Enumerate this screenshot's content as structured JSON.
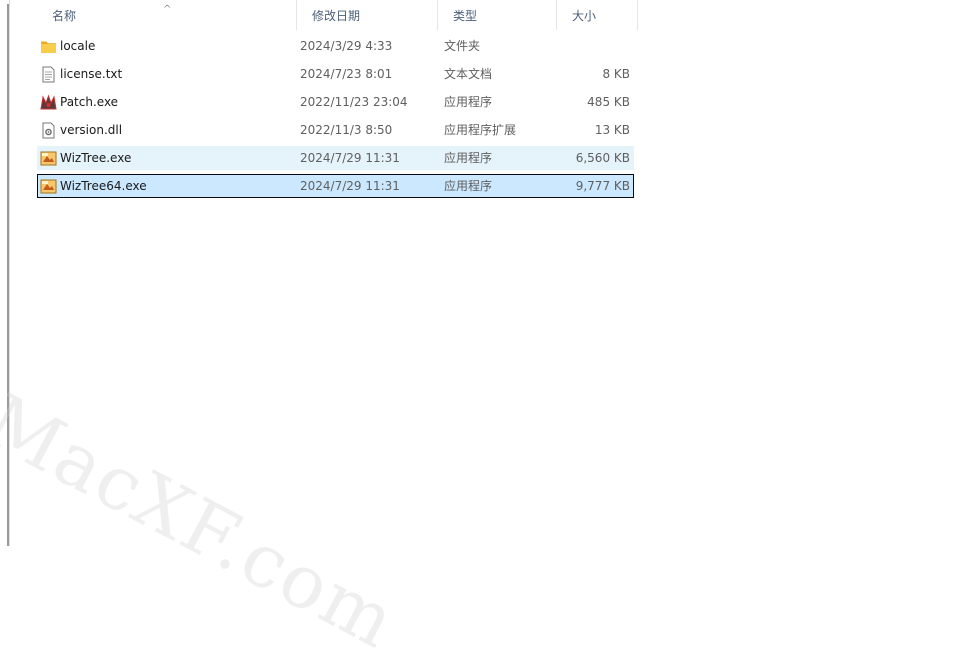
{
  "columns": {
    "name": "名称",
    "modified": "修改日期",
    "type": "类型",
    "size": "大小",
    "sort_indicator": "^"
  },
  "files": [
    {
      "name": "locale",
      "modified": "2024/3/29 4:33",
      "type": "文件夹",
      "size": "",
      "icon": "folder-icon",
      "state": "normal"
    },
    {
      "name": "license.txt",
      "modified": "2024/7/23 8:01",
      "type": "文本文档",
      "size": "8 KB",
      "icon": "text-file-icon",
      "state": "normal"
    },
    {
      "name": "Patch.exe",
      "modified": "2022/11/23 23:04",
      "type": "应用程序",
      "size": "485 KB",
      "icon": "patch-exe-icon",
      "state": "normal"
    },
    {
      "name": "version.dll",
      "modified": "2022/11/3 8:50",
      "type": "应用程序扩展",
      "size": "13 KB",
      "icon": "dll-file-icon",
      "state": "normal"
    },
    {
      "name": "WizTree.exe",
      "modified": "2024/7/29 11:31",
      "type": "应用程序",
      "size": "6,560 KB",
      "icon": "wiztree-icon",
      "state": "hover"
    },
    {
      "name": "WizTree64.exe",
      "modified": "2024/7/29 11:31",
      "type": "应用程序",
      "size": "9,777 KB",
      "icon": "wiztree-icon",
      "state": "selected"
    }
  ],
  "colors": {
    "hover_background": "#e5f3fb",
    "selected_background": "#cce8ff",
    "folder": "#f4c542",
    "header_text": "#4c607a"
  },
  "watermark": "MacXF.com"
}
